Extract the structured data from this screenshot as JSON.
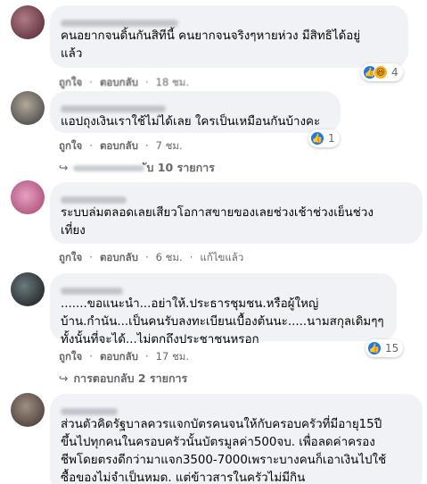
{
  "comments": [
    {
      "text": "คนอยากจนดิ้นกันสิทีนี้ คนยากจนจริงๆหายห่วง มีสิทธิได้อยู่\nแล้ว",
      "like_label": "ถูกใจ",
      "reply_label": "ตอบกลับ",
      "time": "18 ชม.",
      "reactions": {
        "icons": [
          "like-icon",
          "haha-icon"
        ],
        "count": "4"
      }
    },
    {
      "text": "แอปถุงเงินเราใช้ไม่ได้เลย ใครเป็นเหมือนกันบ้างคะ",
      "like_label": "ถูกใจ",
      "reply_label": "ตอบกลับ",
      "time": "7 ชม.",
      "reactions": {
        "icons": [
          "like-icon"
        ],
        "count": "1"
      },
      "view_replies": "ับ 10 รายการ"
    },
    {
      "text": "ระบบล่มตลอดเลยเสียวโอกาสขายของเลยช่วงเช้าช่วงเย็นช่วง\nเที่ยง",
      "like_label": "ถูกใจ",
      "reply_label": "ตอบกลับ",
      "time": "6 ชม.",
      "edited": "แก้ไขแล้ว"
    },
    {
      "text": ".......ขอแนะนำ...อย่าให้.ประธารชุมชน.หรือผู้ใหญ่\nบ้าน.กำนัน...เป็นคนรับลงทะเบียนเบื้องต้นนะ.....นามสกุลเดิมๆๆ\nทั้งนั้นที่จะได้...ไม่ตกถึงประชาชนหรอก",
      "like_label": "ถูกใจ",
      "reply_label": "ตอบกลับ",
      "time": "17 ชม.",
      "reactions": {
        "icons": [
          "like-icon"
        ],
        "count": "15"
      },
      "view_replies": "การตอบกลับ 2 รายการ"
    },
    {
      "text": "ส่วนตัวคิดรัฐบาลควรแจกบัตรคนจนให้กับครอบครัวที่มีอายุ15ปี\nขึ้นไปทุกคนในครอบครัวนั้นบัตรมูลค่า500จบ. เพื่อลดค่าครอง\nชีพโดยตรงดีกว่ามาแจก3500-7000เพราะบางคนก็เอาเงินไปใช้\nซื้อของไม่จำเป็นหมด. แต่ข้าวสารในครัวไม่มีกิน"
    }
  ],
  "colors": {
    "bubble_bg": "#f0f2f5",
    "meta_text": "#65676b",
    "like_blue": "#1877f2",
    "haha_yellow": "#f7b125"
  }
}
